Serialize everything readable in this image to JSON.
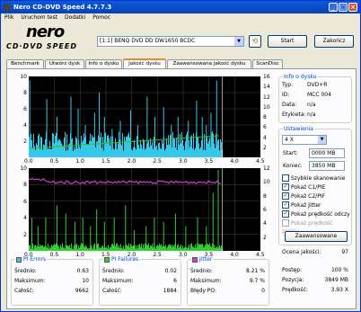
{
  "window": {
    "title": "Nero CD-DVD Speed 4.7.7.3"
  },
  "menu": [
    "Plik",
    "Uruchom test",
    "Dodatki",
    "Pomoc"
  ],
  "logo": {
    "word": "nero",
    "sub": "CD·DVD SPEED"
  },
  "drive": {
    "value": "[1:1]  BENQ DVD DD DW1650 BCDC"
  },
  "buttons": {
    "start": "Start",
    "close": "Zakończ",
    "advanced": "Zaawansowane"
  },
  "tabs": [
    "Benchmark",
    "Utwórz dysk",
    "Info o dysku",
    "Jakość dysku",
    "Zaawansowana jakość dysku",
    "ScanDisc"
  ],
  "active_tab": 3,
  "disc_info": {
    "title": "Info o dysku",
    "rows": [
      {
        "label": "Typ:",
        "value": "DVD+R"
      },
      {
        "label": "ID:",
        "value": "MCC 004"
      },
      {
        "label": "Data:",
        "value": "n/a"
      },
      {
        "label": "Etykieta:",
        "value": "n/a"
      }
    ]
  },
  "settings": {
    "title": "Ustawienia",
    "speed": "4 X",
    "start_label": "Start:",
    "start_value": "0000 MB",
    "end_label": "Koniec:",
    "end_value": "3850 MB",
    "checkboxes": [
      {
        "label": "Szybkie skanowanie",
        "checked": false
      },
      {
        "label": "Pokaż C1/PIE",
        "checked": true
      },
      {
        "label": "Pokaż C2/PIF",
        "checked": true
      },
      {
        "label": "Pokaż Jitter",
        "checked": true
      },
      {
        "label": "Pokaż prędkość odczy",
        "checked": true
      },
      {
        "label": "Pokaż prędkość zapisu",
        "checked": false
      }
    ]
  },
  "quality": {
    "label": "Ocena jakości:",
    "value": "97"
  },
  "progress": {
    "rows": [
      {
        "label": "Postęp:",
        "value": "100 %"
      },
      {
        "label": "Pozycja:",
        "value": "3849 MB"
      },
      {
        "label": "Prędkość:",
        "value": "3.93 X"
      }
    ]
  },
  "stats": {
    "pi_errors": {
      "title": "PI Errors",
      "color": "#36c8e8",
      "rows": [
        {
          "label": "Średnio:",
          "value": "0.63"
        },
        {
          "label": "Maksimum:",
          "value": "10"
        },
        {
          "label": "Całość:",
          "value": "9662"
        }
      ]
    },
    "pi_failures": {
      "title": "PI Failures",
      "color": "#30d030",
      "rows": [
        {
          "label": "Średnio:",
          "value": "0.02"
        },
        {
          "label": "Maksimum:",
          "value": "6"
        },
        {
          "label": "Całość:",
          "value": "1884"
        }
      ]
    },
    "jitter": {
      "title": "Jitter",
      "color": "#d040d0",
      "rows": [
        {
          "label": "Średnio:",
          "value": "8.21 %"
        },
        {
          "label": "Maksimum:",
          "value": "9.7 %"
        },
        {
          "label": "Błędy PO:",
          "value": "0"
        }
      ]
    }
  },
  "chart_data": [
    {
      "type": "bar",
      "name": "PI Errors",
      "x_ticks": [
        "0.0",
        "0.5",
        "1.0",
        "1.5",
        "2.0",
        "2.5",
        "3.0",
        "3.5",
        "4.0",
        "4.5"
      ],
      "y_left_ticks": [
        "10",
        "8",
        "6",
        "4",
        "2"
      ],
      "y_right_ticks": [
        "16",
        "14",
        "12",
        "10",
        "8",
        "6",
        "4",
        "2"
      ],
      "xlim": [
        0,
        4.5
      ],
      "ylim": [
        0,
        10
      ],
      "x_end": 3.76,
      "series": [
        {
          "name": "PI Errors",
          "color": "#36c8e8",
          "typical": 2.0
        },
        {
          "name": "read speed",
          "color": "#30c030"
        }
      ],
      "spikes": [
        {
          "x": 0.02,
          "y": 9.5
        },
        {
          "x": 0.35,
          "y": 7.2
        },
        {
          "x": 0.55,
          "y": 5.0
        },
        {
          "x": 0.82,
          "y": 7.5
        },
        {
          "x": 0.96,
          "y": 6.0
        },
        {
          "x": 1.1,
          "y": 4.0
        },
        {
          "x": 1.28,
          "y": 5.5
        },
        {
          "x": 1.37,
          "y": 8.0
        },
        {
          "x": 1.47,
          "y": 5.0
        },
        {
          "x": 1.62,
          "y": 3.5
        },
        {
          "x": 1.78,
          "y": 4.5
        },
        {
          "x": 1.98,
          "y": 5.8
        },
        {
          "x": 2.12,
          "y": 4.0
        },
        {
          "x": 2.3,
          "y": 7.5
        },
        {
          "x": 2.45,
          "y": 5.0
        },
        {
          "x": 2.62,
          "y": 6.2
        },
        {
          "x": 2.77,
          "y": 4.0
        },
        {
          "x": 2.9,
          "y": 5.0
        },
        {
          "x": 3.1,
          "y": 4.5
        },
        {
          "x": 3.26,
          "y": 7.0
        },
        {
          "x": 3.37,
          "y": 5.0
        },
        {
          "x": 3.45,
          "y": 4.0
        },
        {
          "x": 3.54,
          "y": 5.5
        },
        {
          "x": 3.65,
          "y": 9.5
        }
      ]
    },
    {
      "type": "bar",
      "name": "PI Failures",
      "x_ticks": [
        "0.0",
        "0.5",
        "1.0",
        "1.5",
        "2.0",
        "2.5",
        "3.0",
        "3.5",
        "4.0",
        "4.5"
      ],
      "y_left_ticks": [
        "10",
        "8",
        "6",
        "4",
        "2"
      ],
      "y_right_ticks": [
        "12",
        "10",
        "8",
        "6",
        "4",
        "2"
      ],
      "xlim": [
        0,
        4.5
      ],
      "ylim": [
        0,
        10
      ],
      "x_end": 3.76,
      "series": [
        {
          "name": "PI Failures",
          "color": "#30d030",
          "typical": 0.6
        },
        {
          "name": "Jitter",
          "color": "#d040d0",
          "level": 8.3
        }
      ],
      "spikes": [
        {
          "x": 0.06,
          "y": 4.0
        },
        {
          "x": 0.18,
          "y": 3.0
        },
        {
          "x": 0.33,
          "y": 4.0
        },
        {
          "x": 0.55,
          "y": 5.5
        },
        {
          "x": 0.72,
          "y": 4.5
        },
        {
          "x": 0.9,
          "y": 3.5
        },
        {
          "x": 1.05,
          "y": 4.0
        },
        {
          "x": 1.2,
          "y": 3.0
        },
        {
          "x": 1.32,
          "y": 5.0
        },
        {
          "x": 1.47,
          "y": 3.5
        },
        {
          "x": 1.66,
          "y": 4.0
        },
        {
          "x": 1.88,
          "y": 5.5
        },
        {
          "x": 2.05,
          "y": 2.5
        },
        {
          "x": 2.28,
          "y": 3.0
        },
        {
          "x": 2.44,
          "y": 4.0
        },
        {
          "x": 2.62,
          "y": 3.5
        },
        {
          "x": 2.85,
          "y": 4.5
        },
        {
          "x": 3.05,
          "y": 3.0
        },
        {
          "x": 3.28,
          "y": 4.0
        },
        {
          "x": 3.45,
          "y": 3.0
        },
        {
          "x": 3.58,
          "y": 7.0
        },
        {
          "x": 3.68,
          "y": 9.8
        }
      ]
    }
  ]
}
